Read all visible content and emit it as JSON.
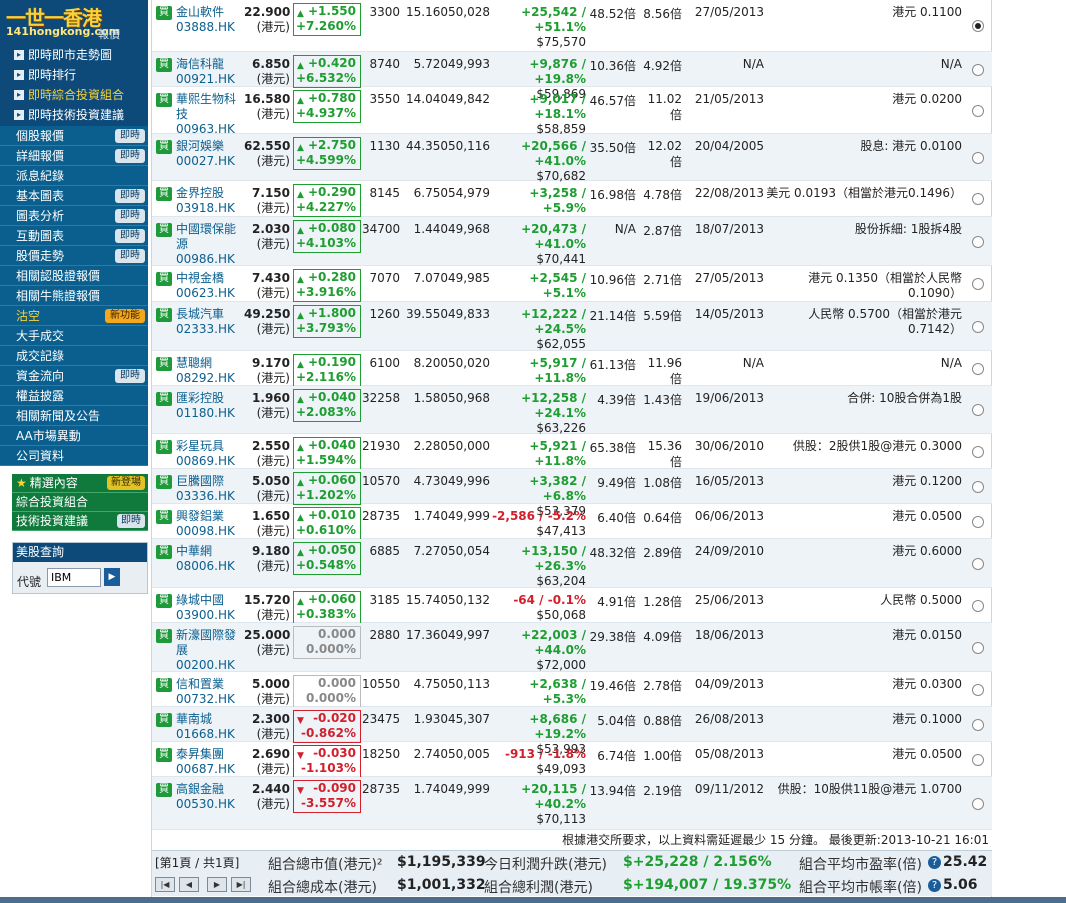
{
  "logo": {
    "brand": "一世一香港",
    "domain": "141hongkong.com",
    "suffix": "報價"
  },
  "submenu": [
    {
      "label": "即時即市走勢圖",
      "active": false
    },
    {
      "label": "即時排行",
      "active": false
    },
    {
      "label": "即時綜合投資組合",
      "active": true
    },
    {
      "label": "即時技術投資建議",
      "active": false
    }
  ],
  "menu": [
    {
      "label": "個股報價",
      "badge": "即時"
    },
    {
      "label": "詳細報價",
      "badge": "即時"
    },
    {
      "label": "派息紀錄",
      "badge": ""
    },
    {
      "label": "基本圖表",
      "badge": "即時"
    },
    {
      "label": "圖表分析",
      "badge": "即時"
    },
    {
      "label": "互動圖表",
      "badge": "即時"
    },
    {
      "label": "股價走勢",
      "badge": "即時"
    },
    {
      "label": "相關認股證報價",
      "badge": ""
    },
    {
      "label": "相關牛熊證報價",
      "badge": ""
    },
    {
      "label": "沽空",
      "badge": "新功能",
      "highlight": true
    },
    {
      "label": "大手成交",
      "badge": ""
    },
    {
      "label": "成交記錄",
      "badge": ""
    },
    {
      "label": "資金流向",
      "badge": "即時"
    },
    {
      "label": "權益披露",
      "badge": ""
    },
    {
      "label": "相關新聞及公告",
      "badge": ""
    },
    {
      "label": "AA市場異動",
      "badge": ""
    },
    {
      "label": "公司資料",
      "badge": ""
    }
  ],
  "green_menu": [
    {
      "label": "精選內容",
      "badge": "新登場",
      "star": true
    },
    {
      "label": "綜合投資組合",
      "badge": "",
      "star": false
    },
    {
      "label": "技術投資建議",
      "badge": "即時",
      "star": false
    }
  ],
  "us_quote": {
    "title": "美股查詢",
    "label": "代號",
    "value": "IBM",
    "go": "▶"
  },
  "buy_label": "買",
  "cur_label": "(港元)",
  "rows": [
    {
      "name": "金山軟件",
      "code": "03888.HK",
      "price": "22.900",
      "chg": "+1.550",
      "chgpct": "+7.260%",
      "dir": "up",
      "qty": "3300",
      "cost": "15.160",
      "mval": "50,028",
      "pl1": "+25,542 /",
      "pl2": "+51.1%",
      "plv": "$75,570",
      "pldir": "up",
      "pe": "48.52倍",
      "pb": "8.56倍",
      "date": "27/05/2013",
      "div": "港元 0.1100",
      "selected": true
    },
    {
      "name": "海信科龍",
      "code": "00921.HK",
      "price": "6.850",
      "chg": "+0.420",
      "chgpct": "+6.532%",
      "dir": "up",
      "qty": "8740",
      "cost": "5.720",
      "mval": "49,993",
      "pl1": "+9,876 / +19.8%",
      "pl2": "",
      "plv": "$59,869",
      "pldir": "up",
      "pe": "10.36倍",
      "pb": "4.92倍",
      "date": "N/A",
      "div": "N/A",
      "selected": false
    },
    {
      "name": "華熙生物科技",
      "code": "00963.HK",
      "price": "16.580",
      "chg": "+0.780",
      "chgpct": "+4.937%",
      "dir": "up",
      "qty": "3550",
      "cost": "14.040",
      "mval": "49,842",
      "pl1": "+9,017 / +18.1%",
      "pl2": "",
      "plv": "$58,859",
      "pldir": "up",
      "pe": "46.57倍",
      "pb": "11.02倍",
      "date": "21/05/2013",
      "div": "港元 0.0200",
      "selected": false
    },
    {
      "name": "銀河娛樂",
      "code": "00027.HK",
      "price": "62.550",
      "chg": "+2.750",
      "chgpct": "+4.599%",
      "dir": "up",
      "qty": "1130",
      "cost": "44.350",
      "mval": "50,116",
      "pl1": "+20,566 /",
      "pl2": "+41.0%",
      "plv": "$70,682",
      "pldir": "up",
      "pe": "35.50倍",
      "pb": "12.02倍",
      "date": "20/04/2005",
      "div": "股息: 港元 0.0100",
      "selected": false
    },
    {
      "name": "金界控股",
      "code": "03918.HK",
      "price": "7.150",
      "chg": "+0.290",
      "chgpct": "+4.227%",
      "dir": "up",
      "qty": "8145",
      "cost": "6.750",
      "mval": "54,979",
      "pl1": "+3,258 / +5.9%",
      "pl2": "",
      "plv": "$58,237",
      "pldir": "up",
      "pe": "16.98倍",
      "pb": "4.78倍",
      "date": "22/08/2013",
      "div": "美元 0.0193（相當於港元0.1496）",
      "selected": false
    },
    {
      "name": "中國環保能源",
      "code": "00986.HK",
      "price": "2.030",
      "chg": "+0.080",
      "chgpct": "+4.103%",
      "dir": "up",
      "qty": "34700",
      "cost": "1.440",
      "mval": "49,968",
      "pl1": "+20,473 /",
      "pl2": "+41.0%",
      "plv": "$70,441",
      "pldir": "up",
      "pe": "N/A",
      "pb": "2.87倍",
      "date": "18/07/2013",
      "div": "股份拆細: 1股拆4股",
      "selected": false
    },
    {
      "name": "中視金橋",
      "code": "00623.HK",
      "price": "7.430",
      "chg": "+0.280",
      "chgpct": "+3.916%",
      "dir": "up",
      "qty": "7070",
      "cost": "7.070",
      "mval": "49,985",
      "pl1": "+2,545 / +5.1%",
      "pl2": "",
      "plv": "$52,530",
      "pldir": "up",
      "pe": "10.96倍",
      "pb": "2.71倍",
      "date": "27/05/2013",
      "div": "港元 0.1350（相當於人民幣0.1090）",
      "selected": false
    },
    {
      "name": "長城汽車",
      "code": "02333.HK",
      "price": "49.250",
      "chg": "+1.800",
      "chgpct": "+3.793%",
      "dir": "up",
      "qty": "1260",
      "cost": "39.550",
      "mval": "49,833",
      "pl1": "+12,222 /",
      "pl2": "+24.5%",
      "plv": "$62,055",
      "pldir": "up",
      "pe": "21.14倍",
      "pb": "5.59倍",
      "date": "14/05/2013",
      "div": "人民幣 0.5700（相當於港元0.7142）",
      "selected": false
    },
    {
      "name": "慧聰網",
      "code": "08292.HK",
      "price": "9.170",
      "chg": "+0.190",
      "chgpct": "+2.116%",
      "dir": "up",
      "qty": "6100",
      "cost": "8.200",
      "mval": "50,020",
      "pl1": "+5,917 / +11.8%",
      "pl2": "",
      "plv": "$55,937",
      "pldir": "up",
      "pe": "61.13倍",
      "pb": "11.96倍",
      "date": "N/A",
      "div": "N/A",
      "selected": false
    },
    {
      "name": "匯彩控股",
      "code": "01180.HK",
      "price": "1.960",
      "chg": "+0.040",
      "chgpct": "+2.083%",
      "dir": "up",
      "qty": "32258",
      "cost": "1.580",
      "mval": "50,968",
      "pl1": "+12,258 /",
      "pl2": "+24.1%",
      "plv": "$63,226",
      "pldir": "up",
      "pe": "4.39倍",
      "pb": "1.43倍",
      "date": "19/06/2013",
      "div": "合併: 10股合併為1股",
      "selected": false
    },
    {
      "name": "彩星玩具",
      "code": "00869.HK",
      "price": "2.550",
      "chg": "+0.040",
      "chgpct": "+1.594%",
      "dir": "up",
      "qty": "21930",
      "cost": "2.280",
      "mval": "50,000",
      "pl1": "+5,921 / +11.8%",
      "pl2": "",
      "plv": "$55,922",
      "pldir": "up",
      "pe": "65.38倍",
      "pb": "15.36倍",
      "date": "30/06/2010",
      "div": "供股：2股供1股@港元 0.3000",
      "selected": false
    },
    {
      "name": "巨騰國際",
      "code": "03336.HK",
      "price": "5.050",
      "chg": "+0.060",
      "chgpct": "+1.202%",
      "dir": "up",
      "qty": "10570",
      "cost": "4.730",
      "mval": "49,996",
      "pl1": "+3,382 / +6.8%",
      "pl2": "",
      "plv": "$53,379",
      "pldir": "up",
      "pe": "9.49倍",
      "pb": "1.08倍",
      "date": "16/05/2013",
      "div": "港元 0.1200",
      "selected": false
    },
    {
      "name": "興發鋁業",
      "code": "00098.HK",
      "price": "1.650",
      "chg": "+0.010",
      "chgpct": "+0.610%",
      "dir": "up",
      "qty": "28735",
      "cost": "1.740",
      "mval": "49,999",
      "pl1": "-2,586 / -5.2%",
      "pl2": "",
      "plv": "$47,413",
      "pldir": "dn",
      "pe": "6.40倍",
      "pb": "0.64倍",
      "date": "06/06/2013",
      "div": "港元 0.0500",
      "selected": false
    },
    {
      "name": "中華網",
      "code": "08006.HK",
      "price": "9.180",
      "chg": "+0.050",
      "chgpct": "+0.548%",
      "dir": "up",
      "qty": "6885",
      "cost": "7.270",
      "mval": "50,054",
      "pl1": "+13,150 /",
      "pl2": "+26.3%",
      "plv": "$63,204",
      "pldir": "up",
      "pe": "48.32倍",
      "pb": "2.89倍",
      "date": "24/09/2010",
      "div": "港元 0.6000",
      "selected": false
    },
    {
      "name": "綠城中國",
      "code": "03900.HK",
      "price": "15.720",
      "chg": "+0.060",
      "chgpct": "+0.383%",
      "dir": "up",
      "qty": "3185",
      "cost": "15.740",
      "mval": "50,132",
      "pl1": "-64 / -0.1%",
      "pl2": "",
      "plv": "$50,068",
      "pldir": "dn",
      "pe": "4.91倍",
      "pb": "1.28倍",
      "date": "25/06/2013",
      "div": "人民幣 0.5000",
      "selected": false
    },
    {
      "name": "新濠國際發展",
      "code": "00200.HK",
      "price": "25.000",
      "chg": "0.000",
      "chgpct": "0.000%",
      "dir": "flat",
      "qty": "2880",
      "cost": "17.360",
      "mval": "49,997",
      "pl1": "+22,003 /",
      "pl2": "+44.0%",
      "plv": "$72,000",
      "pldir": "up",
      "pe": "29.38倍",
      "pb": "4.09倍",
      "date": "18/06/2013",
      "div": "港元 0.0150",
      "selected": false
    },
    {
      "name": "信和置業",
      "code": "00732.HK",
      "price": "5.000",
      "chg": "0.000",
      "chgpct": "0.000%",
      "dir": "flat",
      "qty": "10550",
      "cost": "4.750",
      "mval": "50,113",
      "pl1": "+2,638 / +5.3%",
      "pl2": "",
      "plv": "$52,750",
      "pldir": "up",
      "pe": "19.46倍",
      "pb": "2.78倍",
      "date": "04/09/2013",
      "div": "港元 0.0300",
      "selected": false
    },
    {
      "name": "華南城",
      "code": "01668.HK",
      "price": "2.300",
      "chg": "-0.020",
      "chgpct": "-0.862%",
      "dir": "dn",
      "qty": "23475",
      "cost": "1.930",
      "mval": "45,307",
      "pl1": "+8,686 / +19.2%",
      "pl2": "",
      "plv": "$53,993",
      "pldir": "up",
      "pe": "5.04倍",
      "pb": "0.88倍",
      "date": "26/08/2013",
      "div": "港元 0.1000",
      "selected": false
    },
    {
      "name": "泰昇集團",
      "code": "00687.HK",
      "price": "2.690",
      "chg": "-0.030",
      "chgpct": "-1.103%",
      "dir": "dn",
      "qty": "18250",
      "cost": "2.740",
      "mval": "50,005",
      "pl1": "-913 / -1.8%",
      "pl2": "",
      "plv": "$49,093",
      "pldir": "dn",
      "pe": "6.74倍",
      "pb": "1.00倍",
      "date": "05/08/2013",
      "div": "港元 0.0500",
      "selected": false
    },
    {
      "name": "高銀金融",
      "code": "00530.HK",
      "price": "2.440",
      "chg": "-0.090",
      "chgpct": "-3.557%",
      "dir": "dn",
      "qty": "28735",
      "cost": "1.740",
      "mval": "49,999",
      "pl1": "+20,115 /",
      "pl2": "+40.2%",
      "plv": "$70,113",
      "pldir": "up",
      "pe": "13.94倍",
      "pb": "2.19倍",
      "date": "09/11/2012",
      "div": "供股：10股供11股@港元 1.0700",
      "selected": false
    }
  ],
  "note": "根據港交所要求，以上資料需延遲最少 15 分鐘。 最後更新:2013-10-21 16:01",
  "footer": {
    "page": "[第1頁 / 共1頁]",
    "nav": [
      "|◀",
      "◀",
      "▶",
      "▶|"
    ],
    "mv_label": "組合總市值(港元)²",
    "mv_value": "$1,195,339",
    "cost_label": "組合總成本(港元)",
    "cost_value": "$1,001,332",
    "daily_label": "今日利潤升跌(港元)",
    "daily_value": "$+25,228 / 2.156%",
    "total_label": "組合總利潤(港元)",
    "total_value": "$+194,007 / 19.375%",
    "pe_label": "組合平均市盈率(倍)",
    "pe_value": "25.42",
    "pb_label": "組合平均市帳率(倍)",
    "pb_value": "5.06",
    "qm": "?"
  }
}
